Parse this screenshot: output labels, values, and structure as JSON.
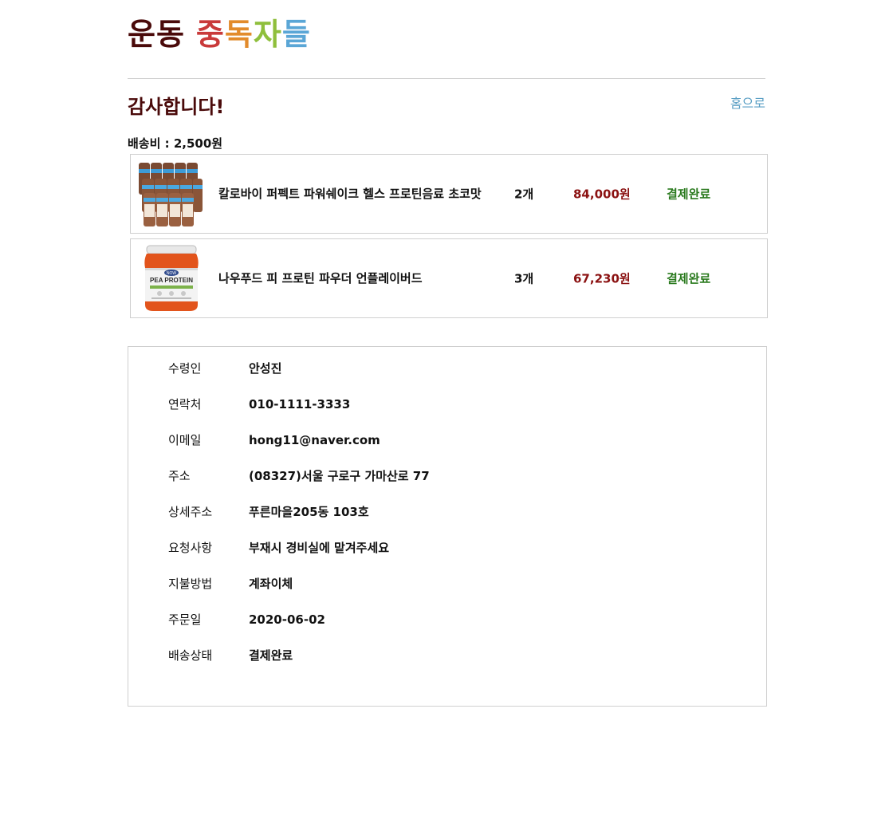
{
  "brand": {
    "word1": "운동",
    "chars": [
      "중",
      "독",
      "자",
      "들"
    ],
    "colors": {
      "word1": "#4a0a0a",
      "char1": "#c93a3a",
      "char2": "#e28b2c",
      "char3": "#8fbf3c",
      "char4": "#5aa6d6"
    }
  },
  "header": {
    "title": "감사합니다!",
    "home_link": "홈으로"
  },
  "shipping": {
    "label": "배송비 : 2,500원"
  },
  "order_items": [
    {
      "image_icon": "chocolate-protein-drink-bottles-image",
      "name": "칼로바이 퍼펙트 파워쉐이크 헬스 프로틴음료 초코맛",
      "quantity": "2개",
      "price": "84,000원",
      "status": "결제완료"
    },
    {
      "image_icon": "pea-protein-tub-image",
      "name": "나우푸드 피 프로틴 파우더 언플레이버드",
      "quantity": "3개",
      "price": "67,230원",
      "status": "결제완료"
    }
  ],
  "product_label": {
    "brand": "NOW",
    "name": "PEA PROTEIN"
  },
  "order_info": [
    {
      "label": "수령인",
      "value": "안성진"
    },
    {
      "label": "연락처",
      "value": "010-1111-3333"
    },
    {
      "label": "이메일",
      "value": "hong11@naver.com"
    },
    {
      "label": "주소",
      "value": "(08327)서울 구로구 가마산로 77"
    },
    {
      "label": "상세주소",
      "value": "푸른마을205동 103호"
    },
    {
      "label": "요청사항",
      "value": "부재시 경비실에 맡겨주세요"
    },
    {
      "label": "지불방법",
      "value": "계좌이체"
    },
    {
      "label": "주문일",
      "value": "2020-06-02"
    },
    {
      "label": "배송상태",
      "value": "결제완료"
    }
  ],
  "colors": {
    "title": "#4a0a0a",
    "link": "#5a9fc4",
    "price": "#8b1212",
    "status": "#2a7a1e",
    "border": "#cfcfcf"
  }
}
